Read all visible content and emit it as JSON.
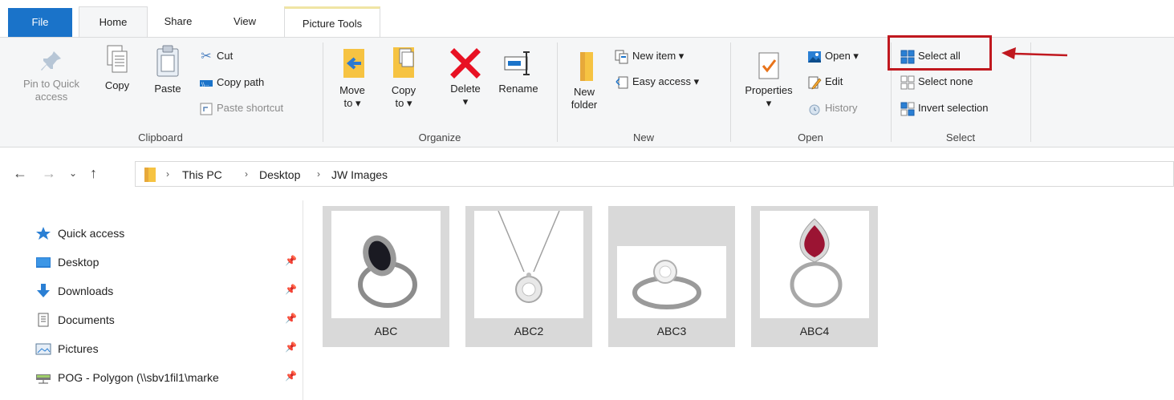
{
  "tabs": {
    "file": "File",
    "home": "Home",
    "share": "Share",
    "view": "View",
    "picture_tools": "Picture Tools"
  },
  "clipboard": {
    "pin_line1": "Pin to Quick",
    "pin_line2": "access",
    "copy": "Copy",
    "paste": "Paste",
    "cut": "Cut",
    "copy_path": "Copy path",
    "paste_shortcut": "Paste shortcut",
    "label": "Clipboard"
  },
  "organize": {
    "move_line1": "Move",
    "move_line2": "to ▾",
    "copy_line1": "Copy",
    "copy_line2": "to ▾",
    "delete": "Delete",
    "delete_arrow": "▾",
    "rename": "Rename",
    "label": "Organize"
  },
  "new": {
    "folder_line1": "New",
    "folder_line2": "folder",
    "new_item": "New item ▾",
    "easy_access": "Easy access ▾",
    "label": "New"
  },
  "open": {
    "properties": "Properties",
    "properties_arrow": "▾",
    "open": "Open ▾",
    "edit": "Edit",
    "history": "History",
    "label": "Open"
  },
  "select": {
    "select_all": "Select all",
    "select_none": "Select none",
    "invert_selection": "Invert selection",
    "label": "Select"
  },
  "breadcrumb": [
    "This PC",
    "Desktop",
    "JW Images"
  ],
  "sidebar": {
    "items": [
      {
        "label": "Quick access",
        "icon": "star-icon"
      },
      {
        "label": "Desktop",
        "icon": "desktop-icon"
      },
      {
        "label": "Downloads",
        "icon": "download-icon"
      },
      {
        "label": "Documents",
        "icon": "document-icon"
      },
      {
        "label": "Pictures",
        "icon": "pictures-icon"
      },
      {
        "label": "POG - Polygon (\\\\sbv1fil1\\marke",
        "icon": "network-drive-icon"
      }
    ]
  },
  "files": [
    {
      "name": "ABC"
    },
    {
      "name": "ABC2"
    },
    {
      "name": "ABC3"
    },
    {
      "name": "ABC4"
    }
  ],
  "colors": {
    "accent": "#1a73c9",
    "highlight": "#c0181f",
    "tab_contextual": "#f0e5a4"
  }
}
